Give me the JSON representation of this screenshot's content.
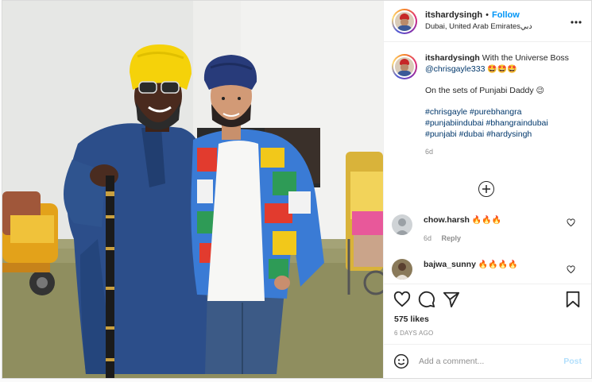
{
  "header": {
    "username": "itshardysingh",
    "separator": "•",
    "follow_label": "Follow",
    "location": "Dubai, United Arab Emiratesدبي",
    "more_icon": "⋮"
  },
  "caption": {
    "username": "itshardysingh",
    "text": "With the Universe Boss",
    "mention": "@chrisgayle333",
    "mention_emoji": "🤩🤩🤩",
    "line2": "On the sets of Punjabi Daddy",
    "line2_emoji": "😉",
    "hashtags_line1": "#chrisgayle #purebhangra",
    "hashtags_line2": "#punjabiindubai #bhangraindubai",
    "hashtags_line3": "#punjabi #dubai #hardysingh",
    "time": "6d"
  },
  "load_more": "+",
  "comments": [
    {
      "username": "chow.harsh",
      "text": "🔥🔥🔥",
      "time": "6d",
      "reply": "Reply"
    },
    {
      "username": "bajwa_sunny",
      "text": "🔥🔥🔥🔥",
      "time": "",
      "reply": ""
    }
  ],
  "engagement": {
    "likes": "575 likes",
    "age": "6 DAYS AGO"
  },
  "composer": {
    "placeholder": "Add a comment...",
    "post_label": "Post"
  },
  "colors": {
    "accent": "#0095f6",
    "link": "#00376b",
    "muted": "#8e8e8e"
  },
  "icons": [
    "heart-icon",
    "comment-icon",
    "share-icon",
    "bookmark-icon",
    "emoji-icon",
    "more-options-icon",
    "plus-circle-icon"
  ]
}
